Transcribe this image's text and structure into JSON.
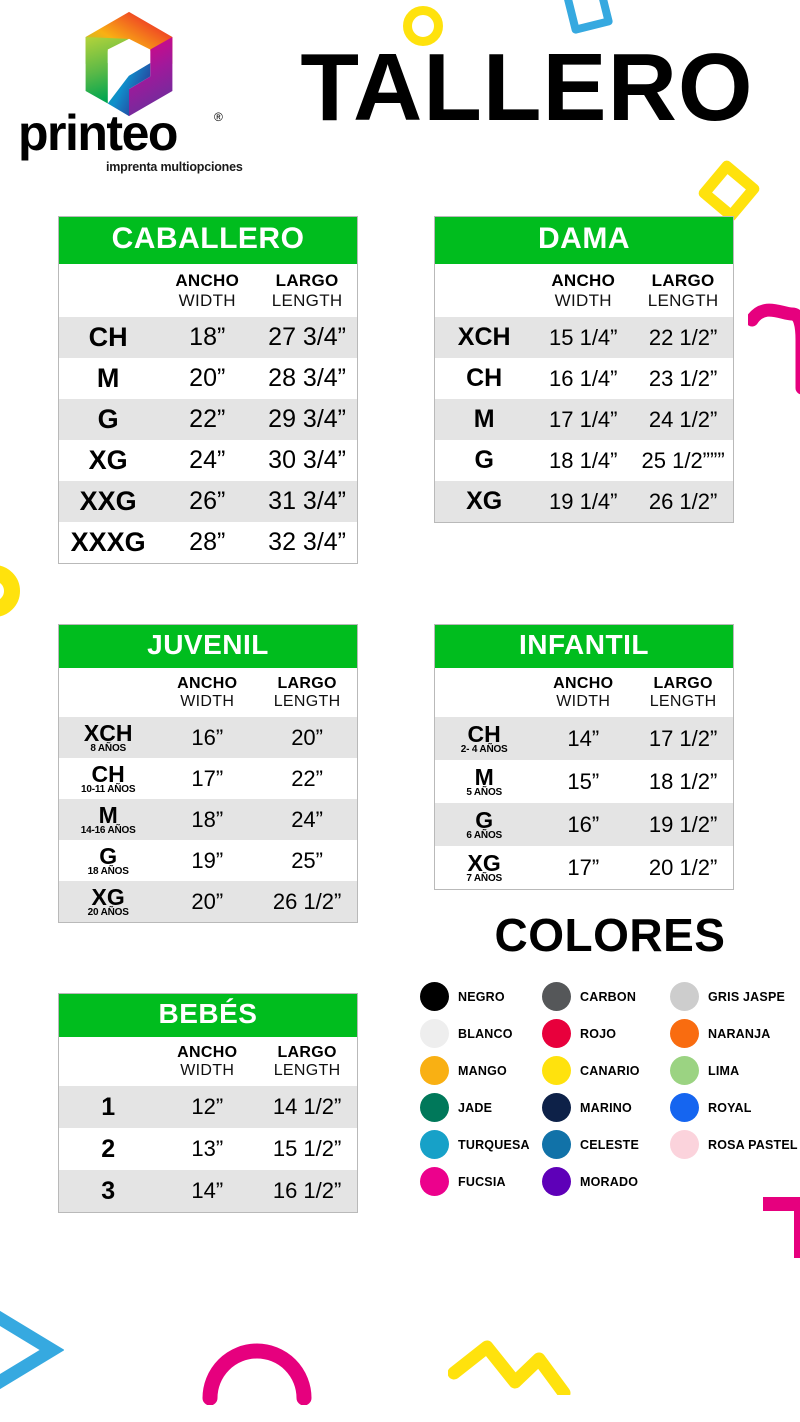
{
  "brand": {
    "name": "printeo",
    "registered": "®",
    "tagline": "imprenta multiopciones"
  },
  "header": {
    "title": "TALLERO"
  },
  "column_headers": {
    "size": "",
    "width_es": "ANCHO",
    "width_en": "WIDTH",
    "length_es": "LARGO",
    "length_en": "LENGTH"
  },
  "tables": [
    {
      "id": "caballero",
      "title": "CABALLERO",
      "rows": [
        {
          "size": "CH",
          "age": "",
          "width": "18”",
          "length": "27 3/4”"
        },
        {
          "size": "M",
          "age": "",
          "width": "20”",
          "length": "28 3/4”"
        },
        {
          "size": "G",
          "age": "",
          "width": "22”",
          "length": "29 3/4”"
        },
        {
          "size": "XG",
          "age": "",
          "width": "24”",
          "length": "30 3/4”"
        },
        {
          "size": "XXG",
          "age": "",
          "width": "26”",
          "length": "31 3/4”"
        },
        {
          "size": "XXXG",
          "age": "",
          "width": "28”",
          "length": "32 3/4”"
        }
      ]
    },
    {
      "id": "dama",
      "title": "DAMA",
      "rows": [
        {
          "size": "XCH",
          "age": "",
          "width": "15 1/4”",
          "length": "22 1/2”"
        },
        {
          "size": "CH",
          "age": "",
          "width": "16 1/4”",
          "length": "23 1/2”"
        },
        {
          "size": "M",
          "age": "",
          "width": "17 1/4”",
          "length": "24 1/2”"
        },
        {
          "size": "G",
          "age": "",
          "width": "18 1/4”",
          "length": "25 1/2”””"
        },
        {
          "size": "XG",
          "age": "",
          "width": "19 1/4”",
          "length": "26 1/2”"
        }
      ]
    },
    {
      "id": "juvenil",
      "title": "JUVENIL",
      "rows": [
        {
          "size": "XCH",
          "age": "8 AÑOS",
          "width": "16”",
          "length": "20”"
        },
        {
          "size": "CH",
          "age": "10-11 AÑOS",
          "width": "17”",
          "length": "22”"
        },
        {
          "size": "M",
          "age": "14-16 AÑOS",
          "width": "18”",
          "length": "24”"
        },
        {
          "size": "G",
          "age": "18 AÑOS",
          "width": "19”",
          "length": "25”"
        },
        {
          "size": "XG",
          "age": "20 AÑOS",
          "width": "20”",
          "length": "26 1/2”"
        }
      ]
    },
    {
      "id": "infantil",
      "title": "INFANTIL",
      "rows": [
        {
          "size": "CH",
          "age": "2- 4 AÑOS",
          "width": "14”",
          "length": "17 1/2”"
        },
        {
          "size": "M",
          "age": "5 AÑOS",
          "width": "15”",
          "length": "18 1/2”"
        },
        {
          "size": "G",
          "age": "6 AÑOS",
          "width": "16”",
          "length": "19 1/2”"
        },
        {
          "size": "XG",
          "age": "7 AÑOS",
          "width": "17”",
          "length": "20 1/2”"
        }
      ]
    },
    {
      "id": "bebes",
      "title": "BEBÉS",
      "rows": [
        {
          "size": "1",
          "age": "",
          "width": "12”",
          "length": "14 1/2”"
        },
        {
          "size": "2",
          "age": "",
          "width": "13”",
          "length": "15 1/2”"
        },
        {
          "size": "3",
          "age": "",
          "width": "14”",
          "length": "16 1/2”"
        }
      ]
    }
  ],
  "colores": {
    "title": "COLORES",
    "swatches": [
      {
        "label": "NEGRO",
        "hex": "#000000"
      },
      {
        "label": "CARBON",
        "hex": "#555759"
      },
      {
        "label": "GRIS JASPE",
        "hex": "#cdcdcd"
      },
      {
        "label": "BLANCO",
        "hex": "#eeeeee"
      },
      {
        "label": "ROJO",
        "hex": "#e8003c"
      },
      {
        "label": "NARANJA",
        "hex": "#f96c10"
      },
      {
        "label": "MANGO",
        "hex": "#f9b013"
      },
      {
        "label": "CANARIO",
        "hex": "#ffe20d"
      },
      {
        "label": "LIMA",
        "hex": "#9bd382"
      },
      {
        "label": "JADE",
        "hex": "#00785a"
      },
      {
        "label": "MARINO",
        "hex": "#0d2148"
      },
      {
        "label": "ROYAL",
        "hex": "#1565f0"
      },
      {
        "label": "TURQUESA",
        "hex": "#17a1c8"
      },
      {
        "label": "CELESTE",
        "hex": "#1172a8"
      },
      {
        "label": "ROSA PASTEL",
        "hex": "#fbd3dc"
      },
      {
        "label": "FUCSIA",
        "hex": "#ec018c"
      },
      {
        "label": "MORADO",
        "hex": "#5e00b8"
      }
    ]
  },
  "theme": {
    "header_green": "#00bd1e",
    "row_alt": "#e4e4e4",
    "border": "#b9b9b9",
    "deco_yellow": "#ffe20d",
    "deco_blue": "#36a9e0",
    "deco_pink": "#e6007e"
  }
}
